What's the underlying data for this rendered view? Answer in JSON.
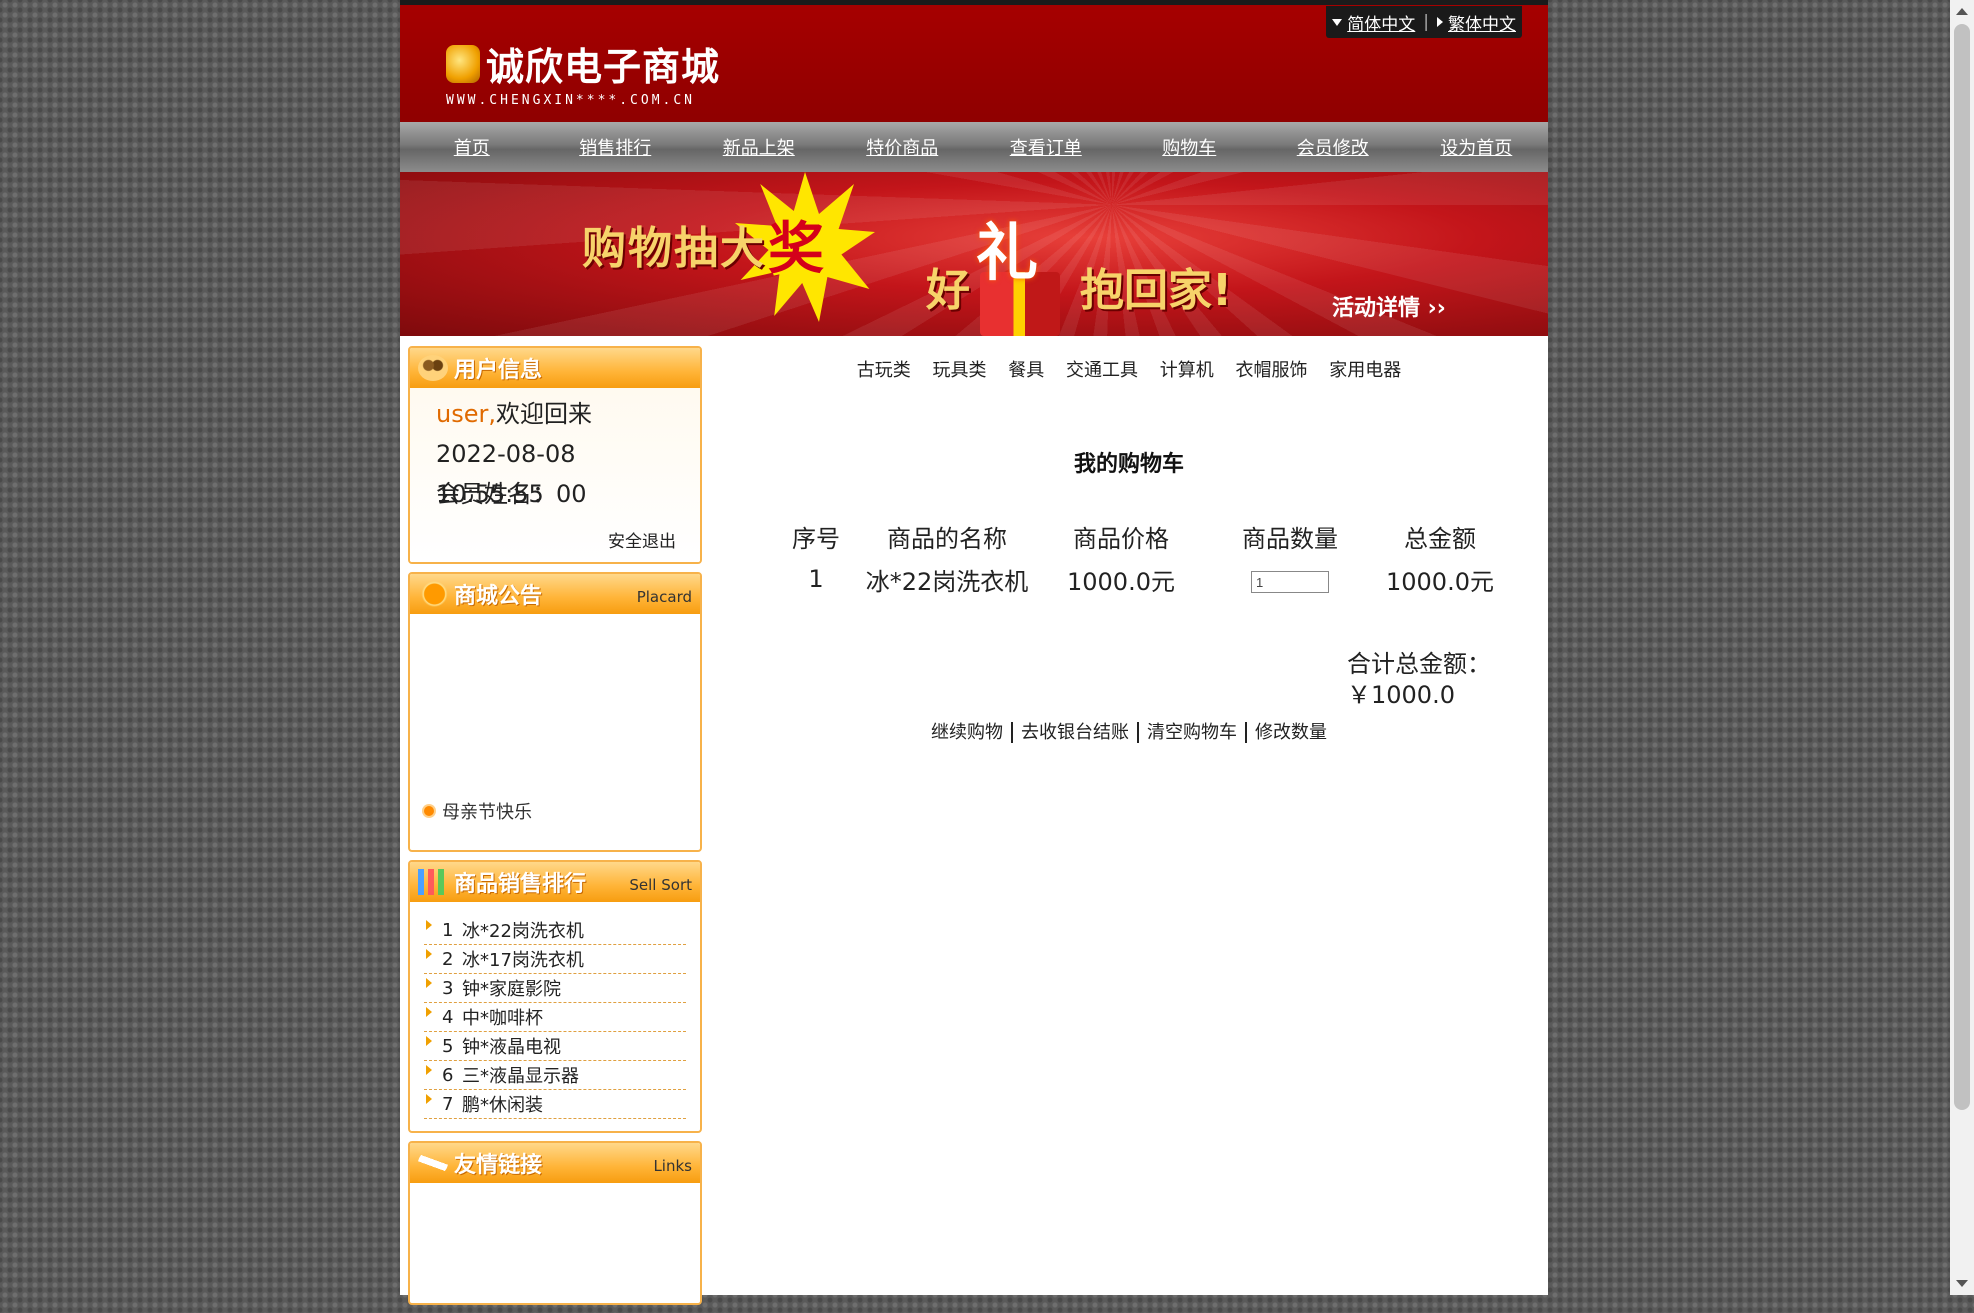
{
  "header": {
    "logo_text": "诚欣电子商城",
    "logo_url_text": "WWW.CHENGXIN****.COM.CN",
    "lang_simplified": "简体中文",
    "lang_traditional": "繁体中文"
  },
  "nav": [
    "首页",
    "销售排行",
    "新品上架",
    "特价商品",
    "查看订单",
    "购物车",
    "会员修改",
    "设为首页"
  ],
  "banner": {
    "line1": "购物抽大",
    "prize_char": "奖",
    "good": "好",
    "gift_char": "礼",
    "line2": "抱回家!",
    "detail": "活动详情 ››"
  },
  "user_box": {
    "title": "用户信息",
    "username": "user,",
    "welcome": "欢迎回来",
    "datetime": "2022-08-08 10:55:55",
    "member_name": "会员姓名：00",
    "logout": "安全退出"
  },
  "placard_box": {
    "title": "商城公告",
    "en": "Placard",
    "items": [
      "母亲节快乐"
    ]
  },
  "rank_box": {
    "title": "商品销售排行",
    "en": "Sell Sort",
    "items": [
      {
        "num": "1",
        "name": "冰*22岗洗衣机"
      },
      {
        "num": "2",
        "name": "冰*17岗洗衣机"
      },
      {
        "num": "3",
        "name": "钟*家庭影院"
      },
      {
        "num": "4",
        "name": "中*咖啡杯"
      },
      {
        "num": "5",
        "name": "钟*液晶电视"
      },
      {
        "num": "6",
        "name": "三*液晶显示器"
      },
      {
        "num": "7",
        "name": "鹏*休闲装"
      }
    ]
  },
  "links_box": {
    "title": "友情链接",
    "en": "Links"
  },
  "categories": [
    "古玩类",
    "玩具类",
    "餐具",
    "交通工具",
    "计算机",
    "衣帽服饰",
    "家用电器"
  ],
  "cart": {
    "title": "我的购物车",
    "columns": [
      "序号",
      "商品的名称",
      "商品价格",
      "商品数量",
      "总金额"
    ],
    "rows": [
      {
        "index": "1",
        "name": "冰*22岗洗衣机",
        "price": "1000.0元",
        "quantity": "1",
        "amount": "1000.0元"
      }
    ],
    "total_label": "合计总金额：",
    "total_value": "￥1000.0",
    "actions": [
      "继续购物",
      "去收银台结账",
      "清空购物车",
      "修改数量"
    ]
  }
}
